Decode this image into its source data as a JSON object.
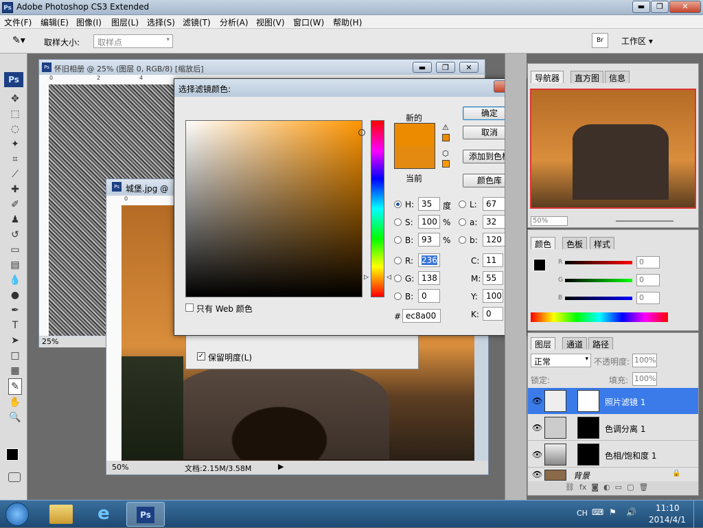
{
  "app": {
    "title": "Adobe Photoshop CS3 Extended",
    "logo": "Ps"
  },
  "menu": [
    "文件(F)",
    "编辑(E)",
    "图像(I)",
    "图层(L)",
    "选择(S)",
    "滤镜(T)",
    "分析(A)",
    "视图(V)",
    "窗口(W)",
    "帮助(H)"
  ],
  "options": {
    "tool_icon": "eyedropper-icon",
    "sample_label": "取样大小:",
    "sample_value": "取样点",
    "workspace": "工作区 ▾"
  },
  "doc1": {
    "title": "怀旧相册 @ 25% (图层 0, RGB/8) [缩放后]",
    "zoom": "25%",
    "ruler_marks": [
      "0",
      "2",
      "4"
    ]
  },
  "doc2": {
    "title": "城堡.jpg @",
    "zoom": "50%",
    "status": "文档:2.15M/3.58M",
    "ruler_marks": [
      "0"
    ]
  },
  "behind_dialog": {
    "checkbox_label": "保留明度(L)",
    "checked": true
  },
  "dialog": {
    "title": "选择滤镜颜色:",
    "new_label": "新的",
    "current_label": "当前",
    "buttons": {
      "ok": "确定",
      "cancel": "取消",
      "add_swatch": "添加到色板",
      "libraries": "颜色库"
    },
    "web_only": "只有 Web 颜色",
    "hsb": [
      {
        "k": "H:",
        "v": "35",
        "u": "度",
        "on": true
      },
      {
        "k": "S:",
        "v": "100",
        "u": "%",
        "on": false
      },
      {
        "k": "B:",
        "v": "93",
        "u": "%",
        "on": false
      }
    ],
    "lab": [
      {
        "k": "L:",
        "v": "67"
      },
      {
        "k": "a:",
        "v": "32"
      },
      {
        "k": "b:",
        "v": "120"
      }
    ],
    "rgb": [
      {
        "k": "R:",
        "v": "236"
      },
      {
        "k": "G:",
        "v": "138"
      },
      {
        "k": "B:",
        "v": "0"
      }
    ],
    "cmyk": [
      {
        "k": "C:",
        "v": "11",
        "u": "%"
      },
      {
        "k": "M:",
        "v": "55",
        "u": "%"
      },
      {
        "k": "Y:",
        "v": "100",
        "u": "%"
      },
      {
        "k": "K:",
        "v": "0",
        "u": "%"
      }
    ],
    "hex_label": "#",
    "hex": "ec8a00",
    "new_color": "#ec8a00",
    "current_color": "#e58a10",
    "hue_color": "#ff9500"
  },
  "navigator": {
    "tabs": [
      "导航器",
      "直方图",
      "信息"
    ],
    "zoom": "50%"
  },
  "color_panel": {
    "tabs": [
      "颜色",
      "色板",
      "样式"
    ],
    "sliders": [
      {
        "k": "R",
        "v": "0"
      },
      {
        "k": "G",
        "v": "0"
      },
      {
        "k": "B",
        "v": "0"
      }
    ]
  },
  "layers_panel": {
    "tabs": [
      "图层",
      "通道",
      "路径"
    ],
    "blend": "正常",
    "opacity_label": "不透明度:",
    "opacity": "100%",
    "lock_label": "锁定:",
    "fill_label": "填充:",
    "fill": "100%",
    "layers": [
      "照片滤镜 1",
      "色调分离 1",
      "色相/饱和度 1",
      "背景"
    ],
    "selected": 0
  },
  "taskbar": {
    "lang": "CH",
    "time": "11:10",
    "date": "2014/4/1"
  }
}
